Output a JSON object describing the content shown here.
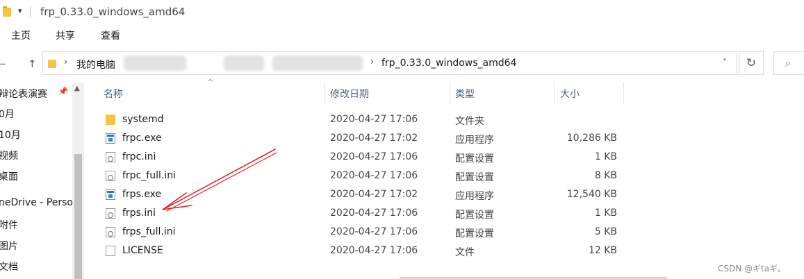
{
  "window": {
    "title": "frp_0.33.0_windows_amd64",
    "quick_access_arrow": "▾"
  },
  "ribbon": {
    "tabs": [
      "主页",
      "共享",
      "查看"
    ]
  },
  "nav_buttons": {
    "back": "←",
    "forward": "→",
    "dropdown": "˅",
    "up": "↑"
  },
  "address": {
    "crumbs": [
      "我的电脑",
      "frp_0.33.0_windows_amd64"
    ],
    "separator": "›",
    "dropdown": "˅",
    "refresh": "↻",
    "search_icon": "⌕"
  },
  "nav_pane": {
    "pin_icon": "📌",
    "scroll_up": "▲",
    "items": [
      "辩论表演赛",
      "0月",
      "10月",
      "视频",
      "桌面",
      "neDrive - Perso",
      "附件",
      "图片",
      "文档"
    ]
  },
  "columns": {
    "name": "名称",
    "date": "修改日期",
    "type": "类型",
    "size": "大小",
    "sort_indicator": "^"
  },
  "files": [
    {
      "icon": "folder-icon",
      "name": "systemd",
      "date": "2020-04-27 17:06",
      "type": "文件夹",
      "size": ""
    },
    {
      "icon": "exe-icon",
      "name": "frpc.exe",
      "date": "2020-04-27 17:02",
      "type": "应用程序",
      "size": "10,286 KB"
    },
    {
      "icon": "ini-icon",
      "name": "frpc.ini",
      "date": "2020-04-27 17:06",
      "type": "配置设置",
      "size": "1 KB"
    },
    {
      "icon": "ini-icon",
      "name": "frpc_full.ini",
      "date": "2020-04-27 17:06",
      "type": "配置设置",
      "size": "8 KB"
    },
    {
      "icon": "exe-icon",
      "name": "frps.exe",
      "date": "2020-04-27 17:02",
      "type": "应用程序",
      "size": "12,540 KB"
    },
    {
      "icon": "ini-icon",
      "name": "frps.ini",
      "date": "2020-04-27 17:06",
      "type": "配置设置",
      "size": "1 KB"
    },
    {
      "icon": "ini-icon",
      "name": "frps_full.ini",
      "date": "2020-04-27 17:06",
      "type": "配置设置",
      "size": "5 KB"
    },
    {
      "icon": "document-icon",
      "name": "LICENSE",
      "date": "2020-04-27 17:06",
      "type": "文件",
      "size": "12 KB"
    }
  ],
  "watermark": "CSDN @ギtaギ。",
  "colors": {
    "annotation_arrow": "#e0262b",
    "folder": "#f6c344",
    "header_text": "#4c607a"
  }
}
